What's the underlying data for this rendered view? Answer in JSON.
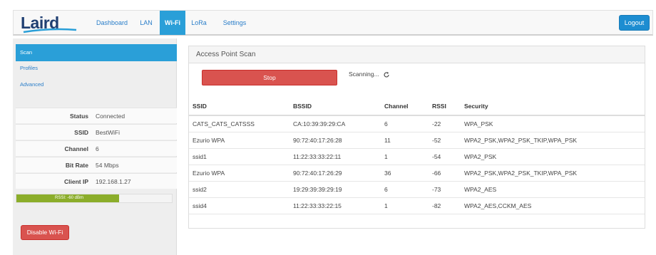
{
  "nav": {
    "logo": "Laird",
    "items": [
      {
        "label": "Dashboard",
        "active": false
      },
      {
        "label": "LAN",
        "active": false
      },
      {
        "label": "Wi-Fi",
        "active": true
      },
      {
        "label": "LoRa",
        "active": false
      },
      {
        "label": "Settings",
        "active": false
      }
    ],
    "logout_label": "Logout"
  },
  "sidebar": {
    "links": [
      {
        "label": "Scan",
        "active": true
      },
      {
        "label": "Profiles",
        "active": false
      },
      {
        "label": "Advanced",
        "active": false
      }
    ],
    "status": [
      {
        "label": "Status",
        "value": "Connected"
      },
      {
        "label": "SSID",
        "value": "BestWiFi"
      },
      {
        "label": "Channel",
        "value": "6"
      },
      {
        "label": "Bit Rate",
        "value": "54 Mbps"
      },
      {
        "label": "Client IP",
        "value": "192.168.1.27"
      }
    ],
    "rssi": {
      "label": "RSSI: -60 dBm",
      "fill_fraction": 0.66,
      "color": "#8bad2a"
    },
    "disable_label": "Disable Wi-Fi"
  },
  "scan": {
    "title": "Access Point Scan",
    "stop_label": "Stop",
    "scanning_text": "Scanning...",
    "headers": {
      "ssid": "SSID",
      "bssid": "BSSID",
      "channel": "Channel",
      "rssi": "RSSI",
      "security": "Security"
    },
    "rows": [
      {
        "ssid": "CATS_CATS_CATSSS",
        "bssid": "CA:10:39:39:29:CA",
        "channel": "6",
        "rssi": "-22",
        "security": "WPA_PSK"
      },
      {
        "ssid": "Ezurio WPA",
        "bssid": "90:72:40:17:26:28",
        "channel": "11",
        "rssi": "-52",
        "security": "WPA2_PSK,WPA2_PSK_TKIP,WPA_PSK"
      },
      {
        "ssid": "ssid1",
        "bssid": "11:22:33:33:22:11",
        "channel": "1",
        "rssi": "-54",
        "security": "WPA2_PSK"
      },
      {
        "ssid": "Ezurio WPA",
        "bssid": "90:72:40:17:26:29",
        "channel": "36",
        "rssi": "-66",
        "security": "WPA2_PSK,WPA2_PSK_TKIP,WPA_PSK"
      },
      {
        "ssid": "ssid2",
        "bssid": "19:29:39:39:29:19",
        "channel": "6",
        "rssi": "-73",
        "security": "WPA2_AES"
      },
      {
        "ssid": "ssid4",
        "bssid": "11:22:33:33:22:15",
        "channel": "1",
        "rssi": "-82",
        "security": "WPA2_AES,CCKM_AES"
      }
    ]
  },
  "colors": {
    "accent": "#2a9fd8",
    "danger": "#d9534f",
    "brand": "#1f3f72"
  }
}
